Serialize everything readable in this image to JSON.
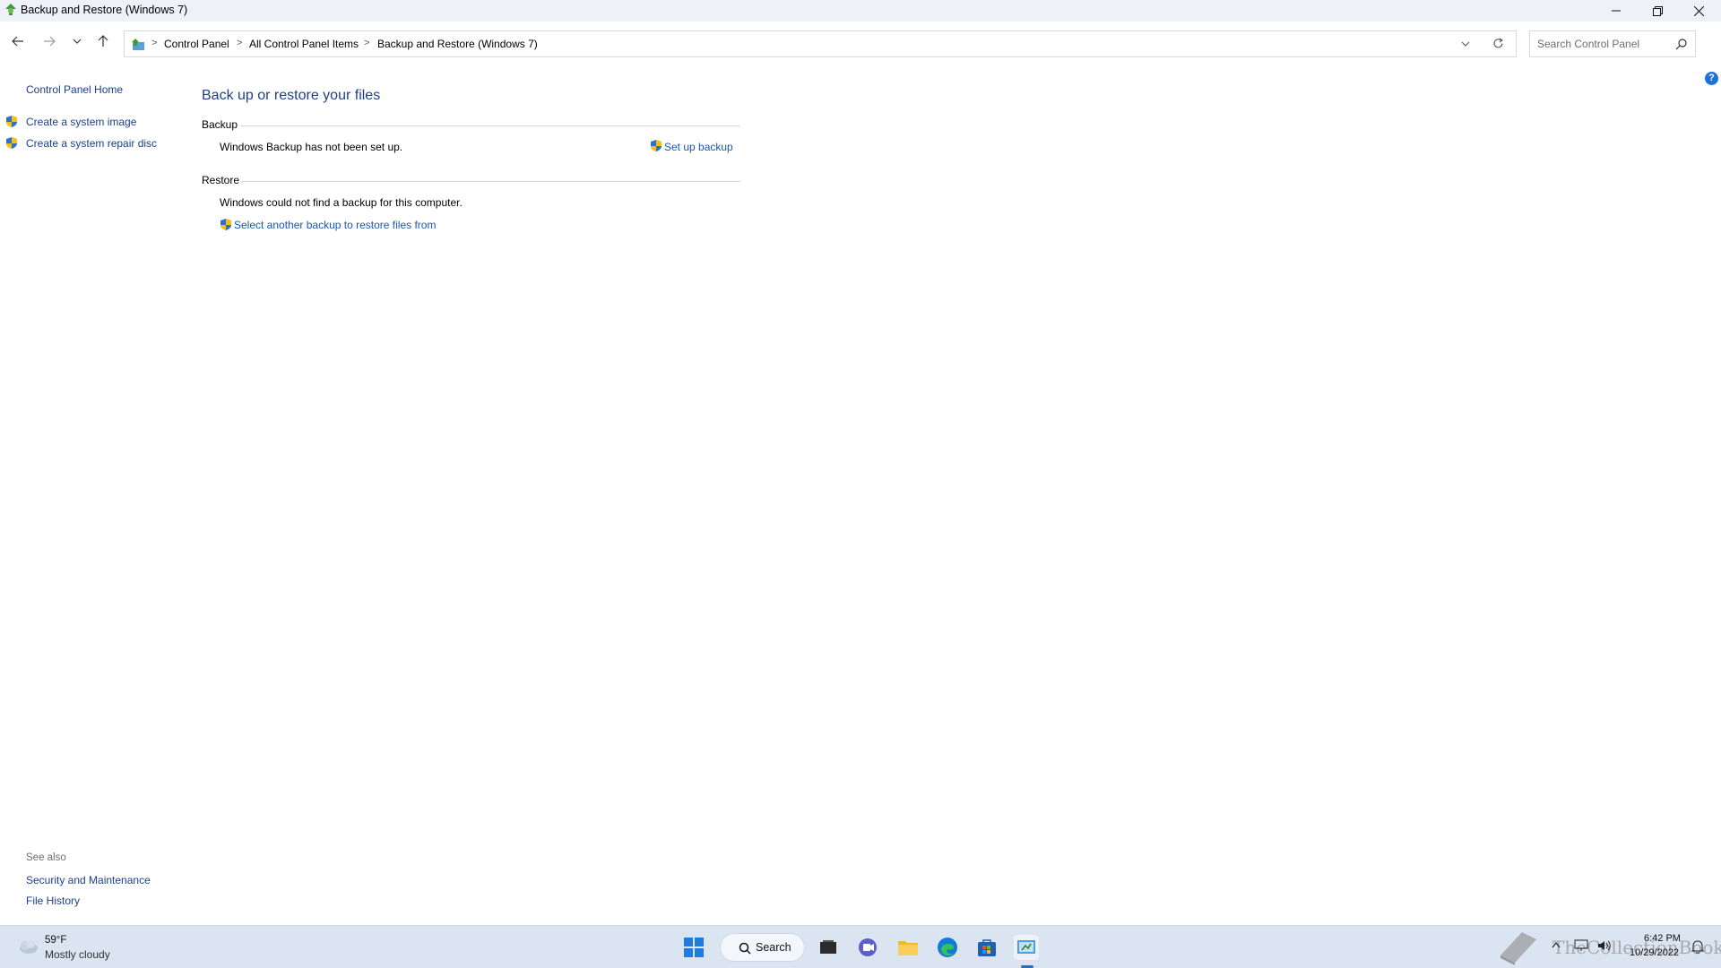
{
  "window": {
    "title": "Backup and Restore (Windows 7)"
  },
  "address_bar": {
    "crumbs": [
      "Control Panel",
      "All Control Panel Items",
      "Backup and Restore (Windows 7)"
    ],
    "search_placeholder": "Search Control Panel"
  },
  "sidebar": {
    "home": "Control Panel Home",
    "tasks": [
      "Create a system image",
      "Create a system repair disc"
    ],
    "see_also_title": "See also",
    "see_also": [
      "Security and Maintenance",
      "File History"
    ]
  },
  "main": {
    "title": "Back up or restore your files",
    "backup": {
      "heading": "Backup",
      "status": "Windows Backup has not been set up.",
      "action": "Set up backup"
    },
    "restore": {
      "heading": "Restore",
      "status": "Windows could not find a backup for this computer.",
      "action": "Select another backup to restore files from"
    },
    "help_glyph": "?"
  },
  "taskbar": {
    "weather_temp": "59°F",
    "weather_desc": "Mostly cloudy",
    "search_label": "Search",
    "time": "6:42 PM",
    "date": "10/29/2022",
    "watermark": "TheCollectionBook"
  },
  "colors": {
    "link": "#1a57b0",
    "title_blue": "#1e3f8a",
    "taskbar_bg": "#dbe4f1"
  }
}
